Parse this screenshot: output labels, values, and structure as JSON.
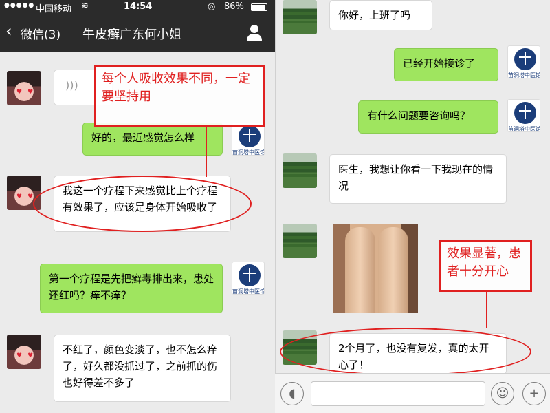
{
  "status": {
    "carrier": "中国移动",
    "time": "14:54",
    "battery": "86%"
  },
  "nav": {
    "back_label": "微信(3)",
    "title": "牛皮癣广东何小姐"
  },
  "left_messages": [
    {
      "text": "好的，最近感觉怎么样"
    },
    {
      "text": "我这一个疗程下来感觉比上个疗程有效果了，应该是身体开始吸收了"
    },
    {
      "text": "第一个疗程是先把癣毒排出来，患处还红吗？痒不痒？"
    },
    {
      "text": "不红了，颜色变淡了，也不怎么痒了，好久都没抓过了，之前抓的伤也好得差不多了"
    }
  ],
  "right_messages": [
    {
      "text": "你好，上班了吗"
    },
    {
      "text": "已经开始接诊了"
    },
    {
      "text": "有什么问题要咨询吗？"
    },
    {
      "text": "医生，我想让你看一下我现在的情况"
    },
    {
      "text": "2个月了，也没有复发，真的太开心了！"
    }
  ],
  "annotations": {
    "left_box": "每个人吸收效果不同，一定要坚持用",
    "right_box": "效果显著，患者十分开心"
  },
  "logo_text": "苗洞塔中医馆",
  "icons": [
    "back-chevron-icon",
    "user-icon",
    "voice-icon",
    "emoji-icon",
    "plus-icon"
  ]
}
